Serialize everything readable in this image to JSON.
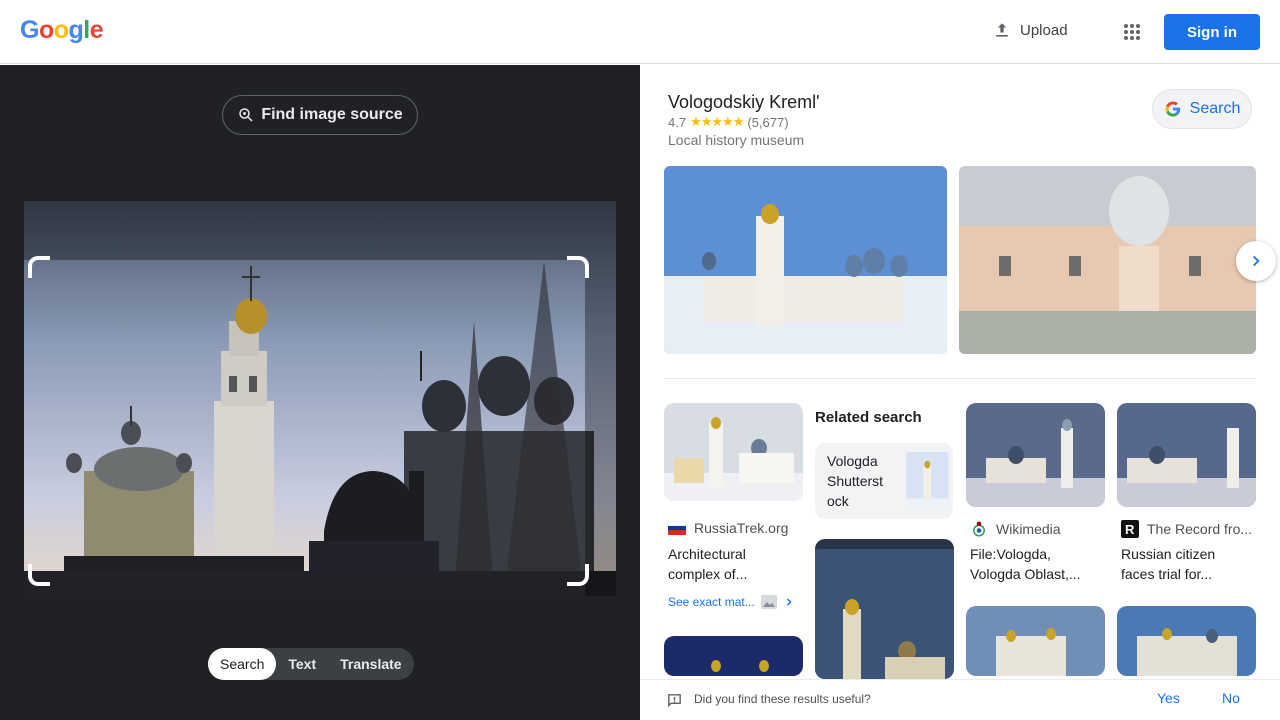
{
  "header": {
    "logo_letters": [
      "G",
      "o",
      "o",
      "g",
      "l",
      "e"
    ],
    "logo_colors": [
      "#4285F4",
      "#EA4335",
      "#FBBC05",
      "#4285F4",
      "#34A853",
      "#EA4335"
    ],
    "upload_label": "Upload",
    "apps_icon": "apps-grid-icon",
    "signin_label": "Sign in"
  },
  "left_panel": {
    "find_source_label": "Find image source",
    "modes": [
      {
        "label": "Search",
        "active": true
      },
      {
        "label": "Text",
        "active": false
      },
      {
        "label": "Translate",
        "active": false
      }
    ]
  },
  "entity": {
    "title": "Vologodskiy Kreml'",
    "rating": "4.7",
    "stars": "★★★★★",
    "reviews": "(5,677)",
    "type": "Local history museum",
    "search_label": "Search"
  },
  "results": [
    {
      "source": "RussiaTrek.org",
      "title": "Architectural complex of...",
      "icon": "russia-flag-icon"
    },
    {
      "source": "Wikimedia",
      "title": "File:Vologda, Vologda Oblast,...",
      "icon": "wikimedia-icon"
    },
    {
      "source": "The Record fro...",
      "title": "Russian citizen faces trial for...",
      "icon": "the-record-icon"
    }
  ],
  "see_exact_label": "See exact mat...",
  "related": {
    "heading": "Related search",
    "card_text": "Vologda Shutterst ock"
  },
  "feedback": {
    "question": "Did you find these results useful?",
    "yes": "Yes",
    "no": "No"
  },
  "colors": {
    "accent": "#1a73e8",
    "dark_panel": "#202124"
  }
}
